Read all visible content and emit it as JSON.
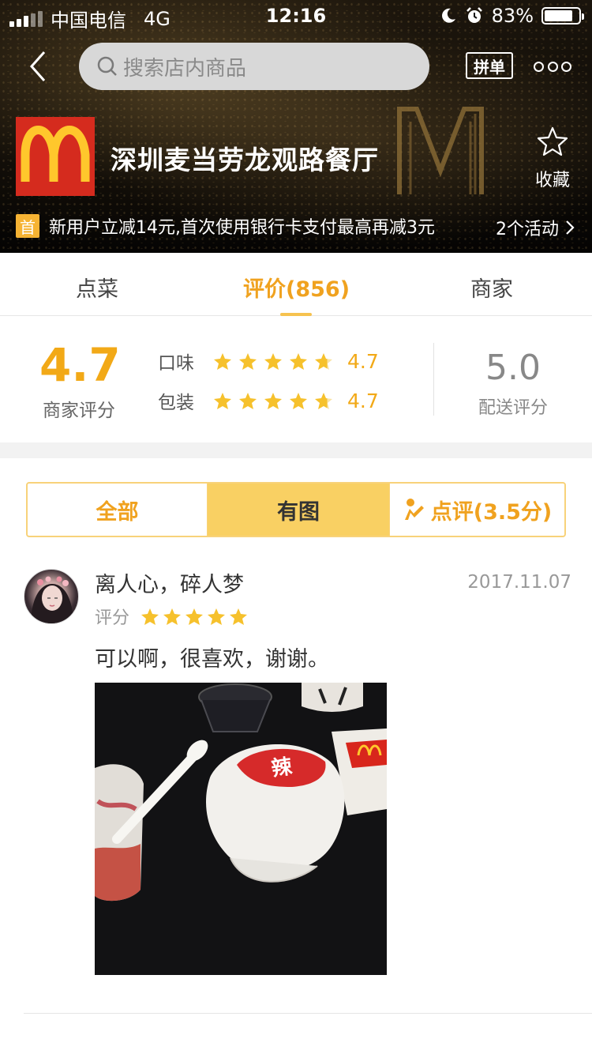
{
  "status_bar": {
    "carrier": "中国电信",
    "network": "4G",
    "time": "12:16",
    "battery": "83%",
    "battery_level": 0.83
  },
  "header": {
    "search_placeholder": "搜索店内商品",
    "group_button": "拼单",
    "store_name": "深圳麦当劳龙观路餐厅",
    "favorite_label": "收藏",
    "promo_tag": "首",
    "promo_text": "新用户立减14元,首次使用银行卡支付最高再减3元",
    "promo_count": "2个活动"
  },
  "tabs": [
    {
      "label": "点菜",
      "active": false
    },
    {
      "label": "评价(856)",
      "active": true
    },
    {
      "label": "商家",
      "active": false
    }
  ],
  "rating": {
    "merchant_score": "4.7",
    "merchant_label": "商家评分",
    "taste_label": "口味",
    "taste_score": "4.7",
    "packaging_label": "包装",
    "packaging_score": "4.7",
    "delivery_score": "5.0",
    "delivery_label": "配送评分"
  },
  "filters": {
    "all": "全部",
    "with_photos": "有图",
    "review_score": "点评(3.5分)",
    "selected": "有图"
  },
  "review": {
    "user": "离人心，碎人梦",
    "date": "2017.11.07",
    "score_label": "评分",
    "stars": 5,
    "text": "可以啊，很喜欢，谢谢。"
  },
  "colors": {
    "accent": "#f2a917",
    "segment_selected": "#f9d063",
    "brand_red": "#d52b1e",
    "brand_yellow": "#ffc72c"
  }
}
